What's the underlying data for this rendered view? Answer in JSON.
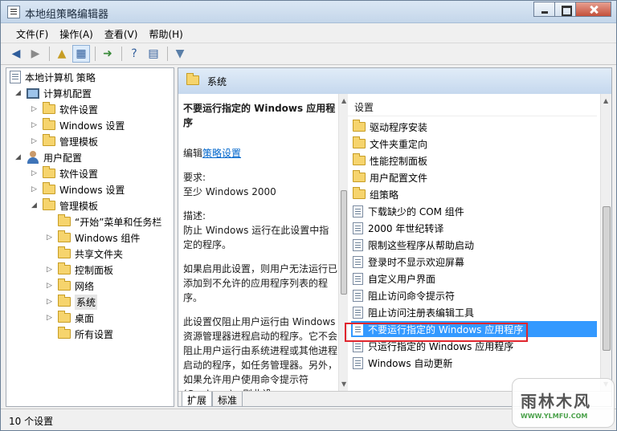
{
  "window": {
    "title": "本地组策略编辑器"
  },
  "menu": [
    "文件(F)",
    "操作(A)",
    "查看(V)",
    "帮助(H)"
  ],
  "toolbar_icons": [
    "back-icon",
    "forward-icon",
    "up-folder-icon",
    "show-hide-tree-icon",
    "export-icon",
    "help-icon",
    "properties-icon",
    "filter-icon"
  ],
  "tree": {
    "root": "本地计算机 策略",
    "computer_config": "计算机配置",
    "computer_children": [
      "软件设置",
      "Windows 设置",
      "管理模板"
    ],
    "user_config": "用户配置",
    "user_children": [
      "软件设置",
      "Windows 设置",
      "管理模板"
    ],
    "admin_template_children": [
      "“开始”菜单和任务栏",
      "Windows 组件",
      "共享文件夹",
      "控制面板",
      "网络",
      "系统",
      "桌面",
      "所有设置"
    ]
  },
  "header": {
    "title": "系统"
  },
  "description": {
    "policy_name": "不要运行指定的 Windows 应用程序",
    "edit_prefix": "编辑",
    "edit_link": "策略设置",
    "requirement_label": "要求:",
    "requirement_value": "至少 Windows 2000",
    "desc_label": "描述:",
    "desc_text": "防止 Windows 运行在此设置中指定的程序。",
    "desc_para2": "如果启用此设置，则用户无法运行已添加到不允许的应用程序列表的程序。",
    "desc_para3": "此设置仅阻止用户运行由 Windows 资源管理器进程启动的程序。它不会阻止用户运行由系统进程或其他进程启动的程序，如任务管理器。另外，如果允许用户使用命令提示符(Cmd.exe)，则此设"
  },
  "settings": {
    "column_header": "设置",
    "folders": [
      "驱动程序安装",
      "文件夹重定向",
      "性能控制面板",
      "用户配置文件",
      "组策略"
    ],
    "policies": [
      "下载缺少的 COM 组件",
      "2000 年世纪转译",
      "限制这些程序从帮助启动",
      "登录时不显示欢迎屏幕",
      "自定义用户界面",
      "阻止访问命令提示符",
      "阻止访问注册表编辑工具",
      "不要运行指定的 Windows 应用程序",
      "只运行指定的 Windows 应用程序",
      "Windows 自动更新"
    ],
    "selected_index": 7
  },
  "tabs": [
    "扩展",
    "标准"
  ],
  "status": {
    "text": "10 个设置"
  },
  "watermark": {
    "brand": "雨林木风",
    "url": "WWW.YLMFU.COM"
  }
}
